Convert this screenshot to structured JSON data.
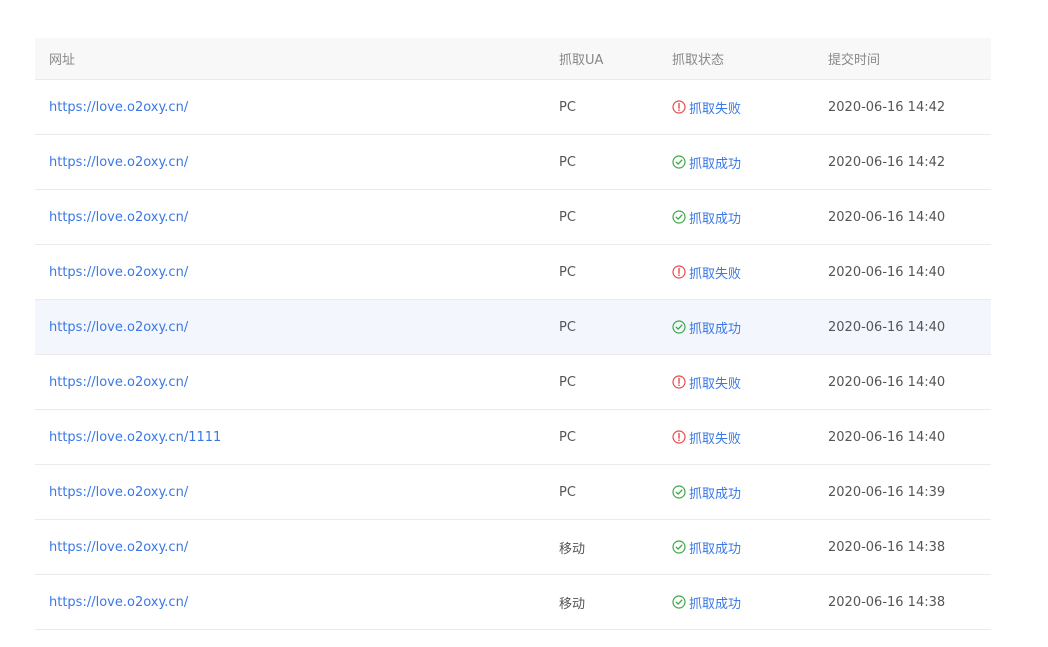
{
  "table": {
    "headers": {
      "url": "网址",
      "ua": "抓取UA",
      "status": "抓取状态",
      "time": "提交时间"
    },
    "rows": [
      {
        "url": "https://love.o2oxy.cn/",
        "ua": "PC",
        "status": "抓取失败",
        "status_type": "fail",
        "time": "2020-06-16 14:42"
      },
      {
        "url": "https://love.o2oxy.cn/",
        "ua": "PC",
        "status": "抓取成功",
        "status_type": "success",
        "time": "2020-06-16 14:42"
      },
      {
        "url": "https://love.o2oxy.cn/",
        "ua": "PC",
        "status": "抓取成功",
        "status_type": "success",
        "time": "2020-06-16 14:40"
      },
      {
        "url": "https://love.o2oxy.cn/",
        "ua": "PC",
        "status": "抓取失败",
        "status_type": "fail",
        "time": "2020-06-16 14:40"
      },
      {
        "url": "https://love.o2oxy.cn/",
        "ua": "PC",
        "status": "抓取成功",
        "status_type": "success",
        "time": "2020-06-16 14:40"
      },
      {
        "url": "https://love.o2oxy.cn/",
        "ua": "PC",
        "status": "抓取失败",
        "status_type": "fail",
        "time": "2020-06-16 14:40"
      },
      {
        "url": "https://love.o2oxy.cn/1111",
        "ua": "PC",
        "status": "抓取失败",
        "status_type": "fail",
        "time": "2020-06-16 14:40"
      },
      {
        "url": "https://love.o2oxy.cn/",
        "ua": "PC",
        "status": "抓取成功",
        "status_type": "success",
        "time": "2020-06-16 14:39"
      },
      {
        "url": "https://love.o2oxy.cn/",
        "ua": "移动",
        "status": "抓取成功",
        "status_type": "success",
        "time": "2020-06-16 14:38"
      },
      {
        "url": "https://love.o2oxy.cn/",
        "ua": "移动",
        "status": "抓取成功",
        "status_type": "success",
        "time": "2020-06-16 14:38"
      }
    ]
  },
  "colors": {
    "link": "#3a78e6",
    "success": "#3aa845",
    "fail": "#e84a4a",
    "hover_row": "#f3f6fd"
  },
  "icons": {
    "success": "check-circle-icon",
    "fail": "exclamation-circle-icon"
  }
}
